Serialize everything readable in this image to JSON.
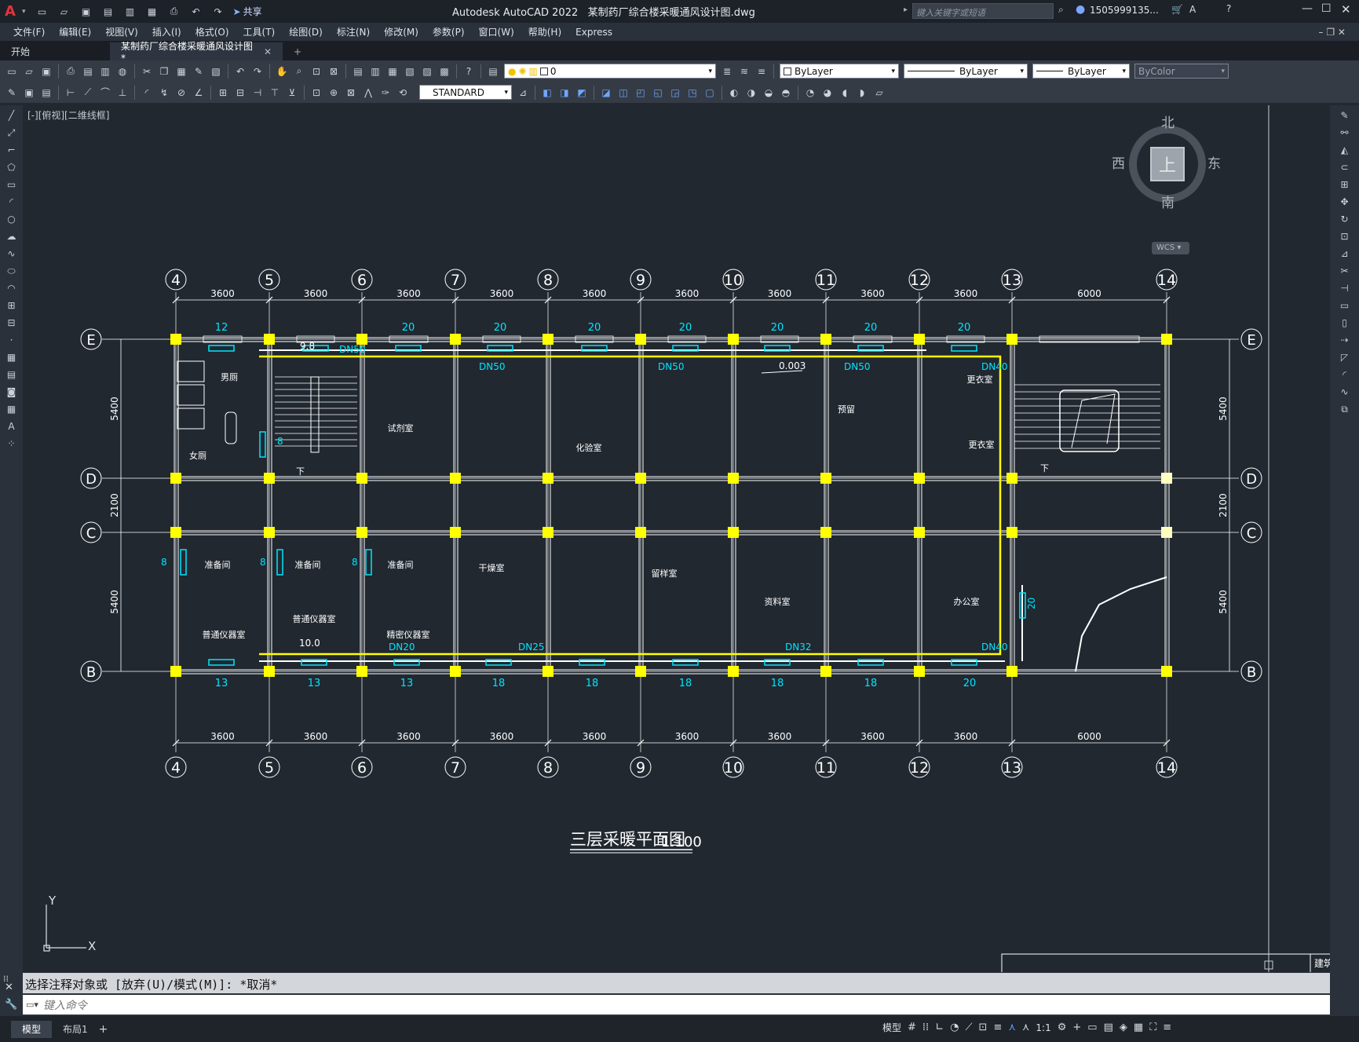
{
  "titlebar": {
    "app": "Autodesk AutoCAD 2022",
    "file": "某制药厂综合楼采暖通风设计图.dwg",
    "share": "共享",
    "search_placeholder": "键入关键字或短语",
    "user": "1505999135...",
    "menu_letter": "A"
  },
  "menu": [
    "文件(F)",
    "编辑(E)",
    "视图(V)",
    "插入(I)",
    "格式(O)",
    "工具(T)",
    "绘图(D)",
    "标注(N)",
    "修改(M)",
    "参数(P)",
    "窗口(W)",
    "帮助(H)",
    "Express"
  ],
  "tabs": {
    "start": "开始",
    "drawing": "某制药厂综合楼采暖通风设计图*",
    "add": "+"
  },
  "props": {
    "layer": "0",
    "color": "ByLayer",
    "linetype": "ByLayer",
    "lineweight": "ByLayer",
    "plotstyle": "ByColor",
    "textstyle": "STANDARD"
  },
  "viewport_label": "[-][俯视][二维线框]",
  "viewcube": {
    "n": "北",
    "s": "南",
    "e": "东",
    "w": "西",
    "top": "上",
    "wcs": "WCS"
  },
  "drawing": {
    "axes_v": [
      "4",
      "5",
      "6",
      "7",
      "8",
      "9",
      "10",
      "11",
      "12",
      "13",
      "14"
    ],
    "axes_h": [
      "E",
      "D",
      "C",
      "B"
    ],
    "spans": [
      "3600",
      "3600",
      "3600",
      "3600",
      "3600",
      "3600",
      "3600",
      "3600",
      "3600",
      "6000"
    ],
    "dims_v": [
      "5400",
      "2100",
      "5400"
    ],
    "top_counts": [
      "12",
      "20",
      "20",
      "20",
      "20",
      "20",
      "20",
      "20"
    ],
    "bottom_counts": [
      "13",
      "13",
      "13",
      "18",
      "18",
      "18",
      "18",
      "18",
      "20"
    ],
    "pipe_labels": [
      "DN50",
      "DN50",
      "DN50",
      "DN50",
      "DN40",
      "DN20",
      "DN25",
      "DN32",
      "DN40"
    ],
    "slope": "0.003",
    "elev_top": "9.8",
    "elev_bottom": "10.0",
    "riser_label": "20",
    "rooms_top": [
      "男厕",
      "女厕",
      "试剂室",
      "化验室",
      "预留",
      "更衣室",
      "更衣室"
    ],
    "rooms_bottom": [
      "准备间",
      "准备间",
      "准备间",
      "普通仪器室",
      "普通仪器室",
      "精密仪器室",
      "干燥室",
      "留样室",
      "资料室",
      "办公室"
    ],
    "title": "三层采暖平面图",
    "scale": "1:100",
    "stair_down": "下",
    "eight": "8",
    "ucs_x": "X",
    "ucs_y": "Y",
    "titleblock": "建筑"
  },
  "command": {
    "history": "选择注释对象或 [放弃(U)/模式(M)]: *取消*",
    "placeholder": "键入命令"
  },
  "status": {
    "model_tab": "模型",
    "layout1": "布局1",
    "model": "模型",
    "scale": "1:1"
  }
}
